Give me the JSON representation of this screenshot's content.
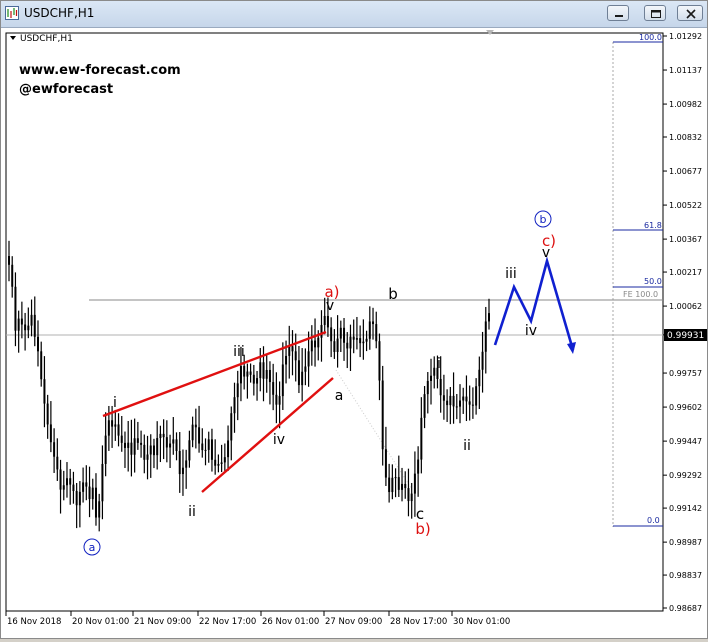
{
  "window": {
    "title": "USDCHF,H1",
    "chart_label": "USDCHF,H1"
  },
  "watermark": {
    "line1": "www.ew-forecast.com",
    "line2": "@ewforecast"
  },
  "colors": {
    "candles": "#000000",
    "red_line": "#e01010",
    "blue_projection": "#1020d0",
    "wave_red": "#dd1111",
    "wave_blue": "#1020c0",
    "fib_line": "#1a2aa0",
    "current_price_bg": "#000000"
  },
  "chart_data": {
    "type": "candlestick",
    "symbol": "USDCHF",
    "timeframe": "H1",
    "ylim": [
      0.98687,
      1.01292
    ],
    "y_ticks": [
      "1.01292",
      "1.01137",
      "1.00982",
      "1.00832",
      "1.00677",
      "1.00522",
      "1.00367",
      "1.00217",
      "1.00062",
      "0.99931",
      "0.99757",
      "0.99602",
      "0.99447",
      "0.99292",
      "0.99142",
      "0.98987",
      "0.98837",
      "0.98687"
    ],
    "current_price": "0.99931",
    "x_ticks": [
      "16 Nov 2018",
      "20 Nov 01:00",
      "21 Nov 09:00",
      "22 Nov 17:00",
      "26 Nov 01:00",
      "27 Nov 09:00",
      "28 Nov 17:00",
      "30 Nov 01:00"
    ],
    "fib_levels": [
      {
        "label": "100.0",
        "value": 1.01292
      },
      {
        "label": "61.8",
        "value": 1.0042
      },
      {
        "label": "50.0",
        "value": 1.0015
      },
      {
        "label": "FE 100.0",
        "value": 1.0009
      },
      {
        "label": "0.0",
        "value": 0.9906
      }
    ],
    "closes": [
      1.0025,
      1.0015,
      0.9995,
      1.00005,
      0.99978,
      0.99952,
      0.99973,
      1.00022,
      0.99922,
      0.99856,
      0.99729,
      0.99618,
      0.99523,
      0.99442,
      0.99376,
      0.99318,
      0.99226,
      0.99246,
      0.99278,
      0.99249,
      0.9922,
      0.99155,
      0.99216,
      0.99259,
      0.9924,
      0.99183,
      0.99235,
      0.99099,
      0.99173,
      0.99343,
      0.99472,
      0.99542,
      0.99513,
      0.99523,
      0.99472,
      0.99439,
      0.99416,
      0.9944,
      0.99385,
      0.9946,
      0.99439,
      0.9943,
      0.99362,
      0.99386,
      0.99427,
      0.99383,
      0.99461,
      0.9948,
      0.99465,
      0.99418,
      0.99436,
      0.99455,
      0.99402,
      0.99297,
      0.99326,
      0.99359,
      0.99451,
      0.99522,
      0.9951,
      0.99436,
      0.99406,
      0.99407,
      0.99455,
      0.99362,
      0.99335,
      0.99343,
      0.9935,
      0.99374,
      0.9945,
      0.99574,
      0.99647,
      0.9971,
      0.99789,
      0.99741,
      0.99764,
      0.99749,
      0.99709,
      0.99734,
      0.99806,
      0.99731,
      0.99771,
      0.99716,
      0.99658,
      0.99613,
      0.99652,
      0.99796,
      0.99835,
      0.99879,
      0.99856,
      0.99815,
      0.99702,
      0.99763,
      0.99787,
      0.99856,
      0.99905,
      0.99874,
      0.99918,
      0.99976,
      1.00017,
      0.99965,
      0.99902,
      0.99853,
      0.99914,
      0.99963,
      0.99895,
      0.99869,
      0.99923,
      0.99909,
      0.99916,
      0.99893,
      0.999,
      0.99913,
      0.99992,
      0.9998,
      0.99902,
      0.99723,
      0.9941,
      0.99281,
      0.99215,
      0.9928,
      0.99283,
      0.99225,
      0.99252,
      0.99233,
      0.99174,
      0.99208,
      0.99299,
      0.99363,
      0.99553,
      0.99661,
      0.99721,
      0.99745,
      0.99781,
      0.9973,
      0.99656,
      0.99631,
      0.99611,
      0.99653,
      0.99605,
      0.99604,
      0.99632,
      0.9965,
      0.99628,
      0.99613,
      0.99609,
      0.99697,
      0.99772,
      0.99854,
      0.99992,
      1.0003
    ]
  },
  "annotations": {
    "ext_circle_a": "a",
    "ext_circle_b": "b",
    "wave_i_1": "i",
    "wave_ii_1": "ii",
    "wave_iii_1": "iii",
    "wave_iv_1": "iv",
    "wave_v_1": "v",
    "wave_a_paren": "a)",
    "wave_a": "a",
    "wave_b": "b",
    "wave_c": "c",
    "wave_b_paren": "b)",
    "wave_i_2": "i",
    "wave_ii_2": "ii",
    "proj_iii": "iii",
    "proj_iv": "iv",
    "proj_v": "v",
    "proj_c_paren": "c)"
  }
}
